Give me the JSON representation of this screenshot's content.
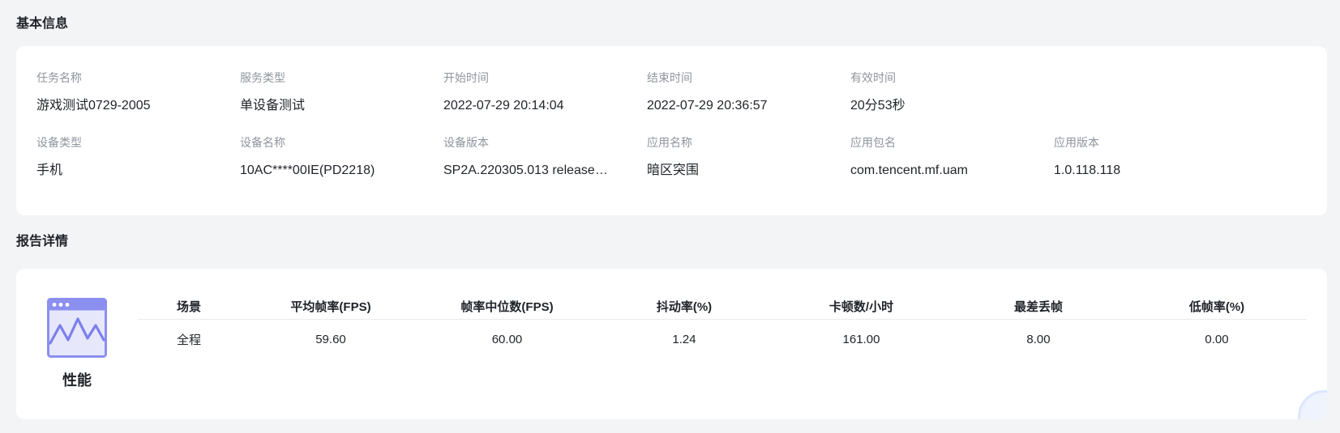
{
  "basic_info": {
    "title": "基本信息",
    "fields": [
      {
        "label": "任务名称",
        "value": "游戏测试0729-2005"
      },
      {
        "label": "服务类型",
        "value": "单设备测试"
      },
      {
        "label": "开始时间",
        "value": "2022-07-29 20:14:04"
      },
      {
        "label": "结束时间",
        "value": "2022-07-29 20:36:57"
      },
      {
        "label": "有效时间",
        "value": "20分53秒"
      },
      {
        "label": "设备类型",
        "value": "手机"
      },
      {
        "label": "设备名称",
        "value": "10AC****00IE(PD2218)"
      },
      {
        "label": "设备版本",
        "value": "SP2A.220305.013 release…"
      },
      {
        "label": "应用名称",
        "value": "暗区突围"
      },
      {
        "label": "应用包名",
        "value": "com.tencent.mf.uam"
      },
      {
        "label": "应用版本",
        "value": "1.0.118.118"
      }
    ]
  },
  "report_details": {
    "title": "报告详情",
    "category_icon": "performance-chart-icon",
    "category_label": "性能",
    "icon_colors": {
      "frame": "#8b8ff0",
      "fill": "#e6e7fb",
      "line": "#7c80ec"
    },
    "table": {
      "headers": [
        "场景",
        "平均帧率(FPS)",
        "帧率中位数(FPS)",
        "抖动率(%)",
        "卡顿数/小时",
        "最差丢帧",
        "低帧率(%)"
      ],
      "rows": [
        [
          "全程",
          "59.60",
          "60.00",
          "1.24",
          "161.00",
          "8.00",
          "0.00"
        ]
      ]
    }
  }
}
